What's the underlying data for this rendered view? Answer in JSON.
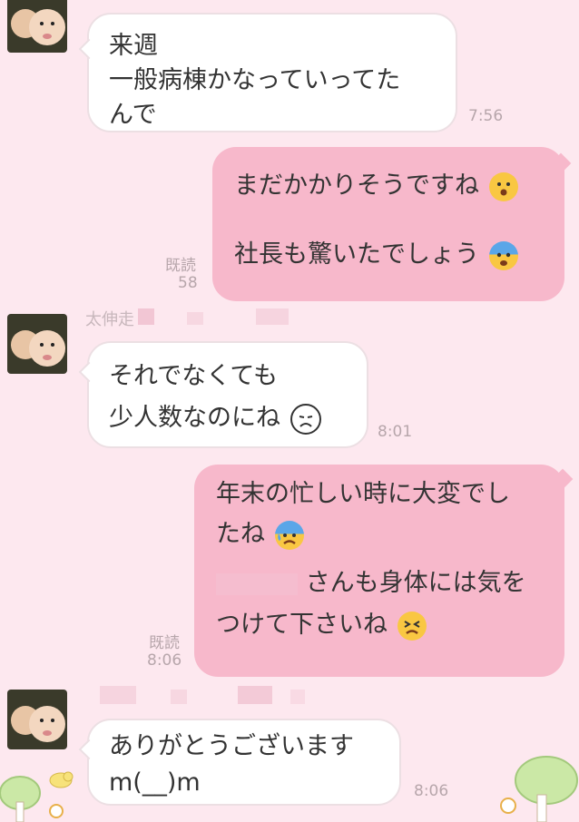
{
  "messages": [
    {
      "lines": [
        "来週",
        "一般病棟かなっていってた",
        "んで"
      ],
      "time": "7:56"
    },
    {
      "lines": [
        "まだかかりそうですね",
        "",
        "社長も驚いたでしょう"
      ],
      "read": "既読",
      "time": "58"
    },
    {
      "sender": "太伸走",
      "lines": [
        "それでなくても",
        "少人数なのにね"
      ],
      "time": "8:01"
    },
    {
      "lines": [
        "年末の忙しい時に大変でし",
        "たね",
        "",
        "さんも身体には気を",
        "つけて下さいね"
      ],
      "read": "既読",
      "time": "8:06"
    },
    {
      "lines": [
        "ありがとうございます",
        "m(__)m"
      ],
      "time": "8:06"
    }
  ],
  "colors": {
    "background": "#fde8ef",
    "outgoing": "#f7b8cb",
    "incoming": "#ffffff"
  },
  "icons": [
    "avatar-photo-icon",
    "surprised-emoji-icon",
    "fearful-emoji-icon",
    "frowning-emoji-icon",
    "cold-sweat-emoji-icon",
    "persevering-emoji-icon",
    "tree-decoration-icon",
    "bird-decoration-icon"
  ]
}
